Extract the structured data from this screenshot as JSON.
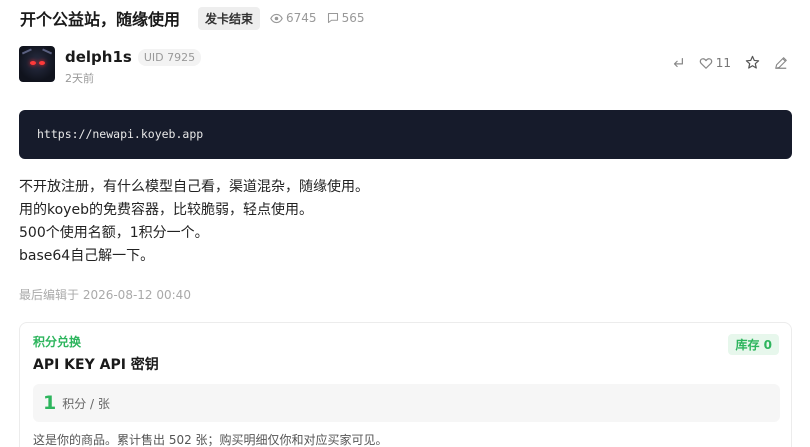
{
  "topic": {
    "title": "开个公益站，随缘使用",
    "tag": "发卡结束",
    "views": "6745",
    "replies": "565"
  },
  "post": {
    "username": "delph1s",
    "uid": "UID 7925",
    "time": "2天前",
    "likes": "11",
    "code": "https://newapi.koyeb.app",
    "paragraphs": [
      "不开放注册，有什么模型自己看，渠道混杂，随缘使用。",
      "用的koyeb的免费容器，比较脆弱，轻点使用。",
      "500个使用名额，1积分一个。",
      "base64自己解一下。"
    ],
    "edit_note": "最后编辑于 2026-08-12 00:40"
  },
  "product": {
    "category": "积分兑换",
    "title": "API KEY  API 密钥",
    "stock": "库存 0",
    "price": "1",
    "unit": "积分 / 张",
    "description": "这是你的商品。累计售出 502 张；购买明细仅你和对应买家可见。"
  },
  "colors": {
    "accent_green": "#2db55d",
    "code_bg": "#161b2b"
  },
  "icons": [
    "eye-icon",
    "chat-bubble-icon",
    "reply-icon",
    "heart-icon",
    "star-icon",
    "pencil-icon"
  ]
}
